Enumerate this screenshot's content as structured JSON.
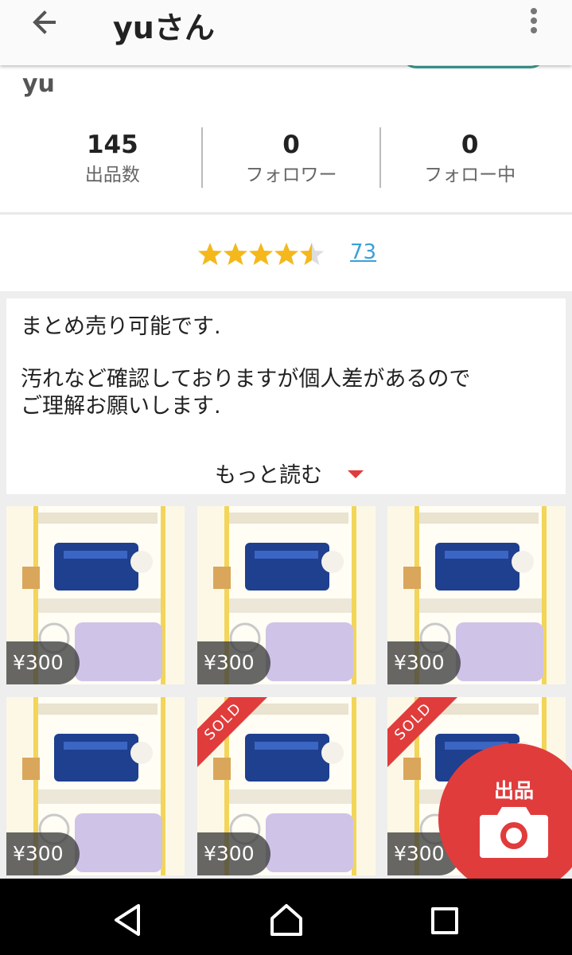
{
  "appbar": {
    "title": "yuさん",
    "back_icon": "arrow-left-icon",
    "more_icon": "more-vertical-icon"
  },
  "profile": {
    "username": "yu",
    "stats": [
      {
        "value": "145",
        "label": "出品数"
      },
      {
        "value": "0",
        "label": "フォロワー"
      },
      {
        "value": "0",
        "label": "フォロー中"
      }
    ]
  },
  "rating": {
    "stars": 4.5,
    "count": "73",
    "star_color": "#f5b81c"
  },
  "description": {
    "line1": "まとめ売り可能です.",
    "line2": "汚れなど確認しておりますが個人差があるので",
    "line3": "ご理解お願いします.",
    "read_more": "もっと読む"
  },
  "items": [
    {
      "price": "¥300",
      "sold": false
    },
    {
      "price": "¥300",
      "sold": false
    },
    {
      "price": "¥300",
      "sold": false
    },
    {
      "price": "¥300",
      "sold": false
    },
    {
      "price": "¥300",
      "sold": true
    },
    {
      "price": "¥300",
      "sold": true
    }
  ],
  "sold_label": "SOLD",
  "fab": {
    "label": "出品",
    "icon": "camera-icon",
    "color": "#e03c3c"
  },
  "navbar": {
    "back_icon": "nav-back-icon",
    "home_icon": "nav-home-icon",
    "recent_icon": "nav-recent-icon"
  }
}
